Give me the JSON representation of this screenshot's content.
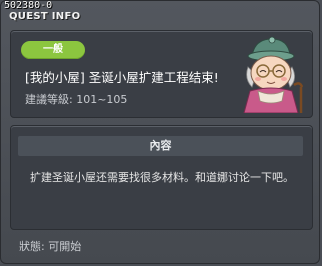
{
  "window": {
    "id_code": "502380-0",
    "title": "QUEST INFO"
  },
  "quest": {
    "category_tag": "一般",
    "name": "[我的小屋] 圣诞小屋扩建工程结束!",
    "level_range": "建議等級: 101~105",
    "npc_icon": "granny-npc-icon"
  },
  "content": {
    "header": "內容",
    "description": "扩建圣诞小屋还需要找很多材料。和道娜讨论一下吧。"
  },
  "status": {
    "text": "狀態: 可開始"
  },
  "colors": {
    "tag_green": "#8cc63f",
    "window_bg": "#4a4e55",
    "panel_bg": "#3a3e45"
  }
}
